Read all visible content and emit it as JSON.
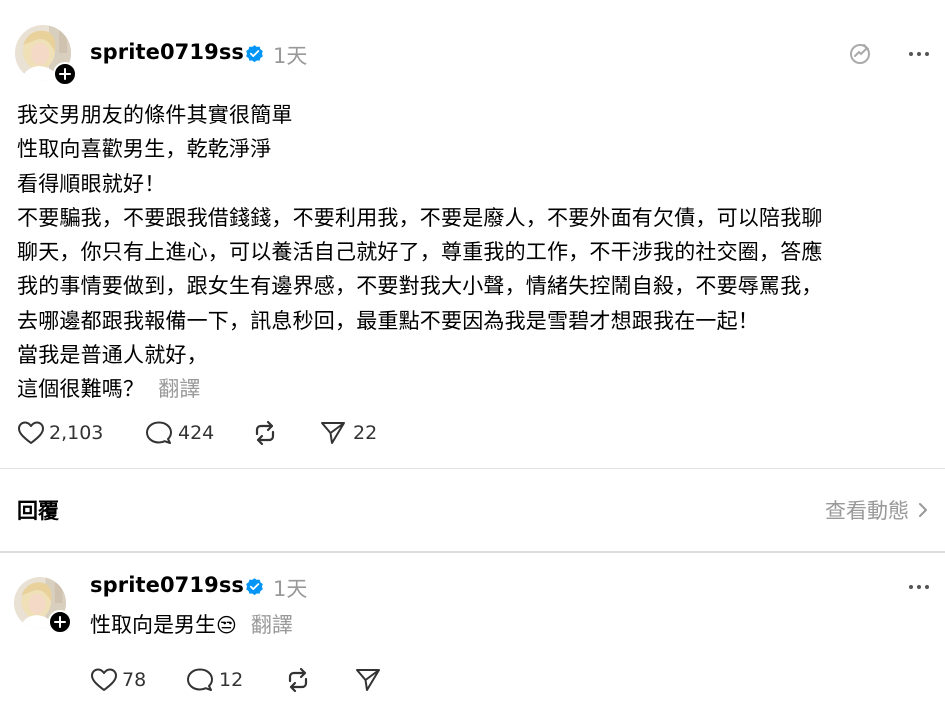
{
  "post": {
    "username": "sprite0719ss",
    "time": "1天",
    "lines": [
      "我交男朋友的條件其實很簡單",
      "性取向喜歡男生，乾乾淨淨",
      "看得順眼就好！",
      "不要騙我，不要跟我借錢錢，不要利用我，不要是廢人，不要外面有欠債，可以陪我聊",
      "聊天，你只有上進心，可以養活自己就好了，尊重我的工作，不干涉我的社交圈，答應",
      "我的事情要做到，跟女生有邊界感，不要對我大小聲，情緒失控鬧自殺，不要辱罵我，",
      "去哪邊都跟我報備一下，訊息秒回，最重點不要因為我是雪碧才想跟我在一起！",
      "當我是普通人就好，",
      "這個很難嗎？"
    ],
    "translate": "翻譯",
    "likes": "2,103",
    "comments": "424",
    "shares": "22"
  },
  "reply_section": {
    "label": "回覆",
    "activity_link": "查看動態"
  },
  "comment": {
    "username": "sprite0719ss",
    "time": "1天",
    "text": "性取向是男生",
    "emoji": "😒",
    "translate": "翻譯",
    "likes": "78",
    "comments": "12"
  },
  "colors": {
    "verified": "#0095f6",
    "muted": "#999999",
    "divider": "#e3e3e3"
  },
  "icons": [
    "plus-icon",
    "verified-badge-icon",
    "mute-icon",
    "more-icon",
    "heart-icon",
    "comment-icon",
    "repost-icon",
    "share-icon",
    "chevron-right-icon"
  ]
}
